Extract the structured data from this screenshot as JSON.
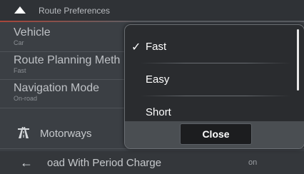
{
  "header": {
    "title": "Route Preferences",
    "icon": "up-arrow-icon"
  },
  "list": {
    "vehicle": {
      "label": "Vehicle",
      "value": "Car"
    },
    "route_planning": {
      "label": "Route Planning Meth",
      "value": "Fast"
    },
    "navigation_mode": {
      "label": "Navigation Mode",
      "value": "On-road"
    },
    "motorways": {
      "label": "Motorways",
      "icon": "motorway-icon"
    },
    "period_charge": {
      "label": "oad With Period Charge",
      "value": "on",
      "icon": "back-arrow-icon",
      "back_glyph": "←"
    }
  },
  "popup": {
    "options": [
      {
        "label": "Fast",
        "selected": true
      },
      {
        "label": "Easy",
        "selected": false
      },
      {
        "label": "Short",
        "selected": false
      }
    ],
    "check_glyph": "✓",
    "close_label": "Close"
  },
  "colors": {
    "accent": "#a8463a",
    "popup_bg": "#2a2c2f",
    "screen_bg": "#3b3f44"
  }
}
